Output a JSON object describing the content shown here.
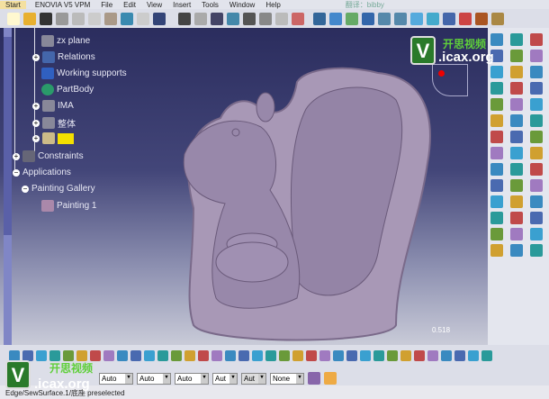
{
  "menu": {
    "items": [
      "Start",
      "ENOVIA V5 VPM",
      "File",
      "Edit",
      "View",
      "Insert",
      "Tools",
      "Window",
      "Help"
    ]
  },
  "tree": {
    "items": [
      {
        "label": "zx plane",
        "icon": "plane-icon"
      },
      {
        "label": "Relations",
        "icon": "relations-icon"
      },
      {
        "label": "Working supports",
        "icon": "grid-icon"
      },
      {
        "label": "PartBody",
        "icon": "gear-icon"
      },
      {
        "label": "IMA",
        "icon": "body-icon"
      },
      {
        "label": "整体",
        "icon": "body-icon"
      },
      {
        "label": "",
        "icon": "highlighted-body-icon"
      },
      {
        "label": "Constraints",
        "icon": "constraints-icon"
      },
      {
        "label": "Applications",
        "icon": ""
      },
      {
        "label": "Painting Gallery",
        "icon": ""
      },
      {
        "label": "Painting 1",
        "icon": "painting-icon"
      }
    ]
  },
  "viewport": {
    "scale": "0.518"
  },
  "watermark": {
    "brand": "开思视频",
    "url": ".icax.org",
    "letter": "V",
    "top_text": "翻译：bibby"
  },
  "bottom": {
    "selects": [
      "Auto",
      "Auto",
      "Auto",
      "Aut",
      "Aut",
      "None"
    ]
  },
  "status": {
    "text": "Edge/SewSurface.1/底座 preselected"
  },
  "colors": {
    "part": "#9c8aac",
    "accent": "#f4e000"
  }
}
